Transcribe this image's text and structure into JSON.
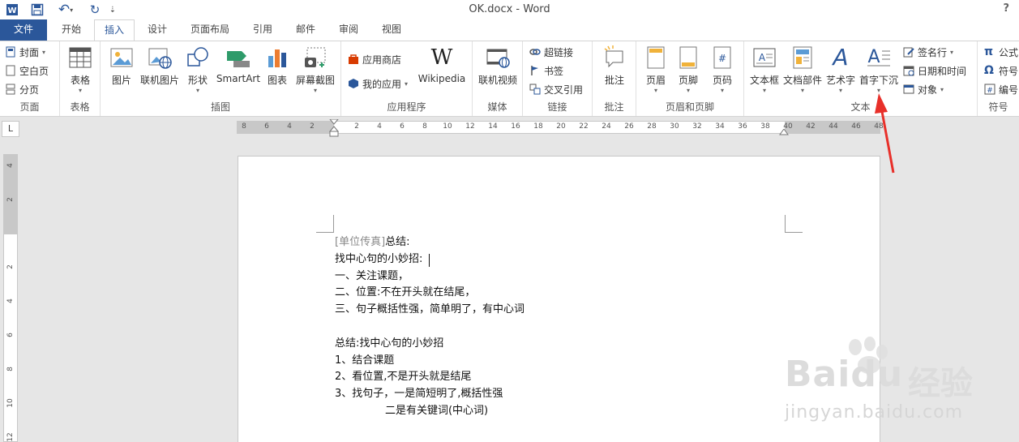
{
  "titlebar": {
    "title": "OK.docx - Word",
    "help": "?",
    "undo": "↶",
    "redo": "↻",
    "save": "💾",
    "customize": "⇣"
  },
  "tabs": {
    "file": "文件",
    "home": "开始",
    "insert": "插入",
    "design": "设计",
    "layout": "页面布局",
    "references": "引用",
    "mailings": "邮件",
    "review": "审阅",
    "view": "视图"
  },
  "ribbon": {
    "pages": {
      "label": "页面",
      "cover": "封面",
      "blank": "空白页",
      "break": "分页"
    },
    "tables": {
      "label": "表格",
      "table": "表格"
    },
    "illustrations": {
      "label": "插图",
      "picture": "图片",
      "online_picture": "联机图片",
      "shapes": "形状",
      "smartart": "SmartArt",
      "chart": "图表",
      "screenshot": "屏幕截图"
    },
    "apps": {
      "label": "应用程序",
      "store": "应用商店",
      "my_apps": "我的应用",
      "wikipedia": "Wikipedia"
    },
    "media": {
      "label": "媒体",
      "online_video": "联机视频"
    },
    "links": {
      "label": "链接",
      "hyperlink": "超链接",
      "bookmark": "书签",
      "cross_ref": "交叉引用"
    },
    "comments": {
      "label": "批注",
      "comment": "批注"
    },
    "header_footer": {
      "label": "页眉和页脚",
      "header": "页眉",
      "footer": "页脚",
      "page_number": "页码"
    },
    "text": {
      "label": "文本",
      "textbox": "文本框",
      "quick_parts": "文档部件",
      "wordart": "艺术字",
      "drop_cap": "首字下沉",
      "signature": "签名行",
      "datetime": "日期和时间",
      "object": "对象"
    },
    "symbols": {
      "label": "符号",
      "equation": "公式",
      "symbol": "符号",
      "number": "编号"
    }
  },
  "ruler": {
    "corner": "L",
    "h_left": [
      "8",
      "6",
      "4",
      "2"
    ],
    "h_right": [
      "2",
      "4",
      "6",
      "8",
      "10",
      "12",
      "14",
      "16",
      "18",
      "20",
      "22",
      "24",
      "26",
      "28",
      "30",
      "32",
      "34",
      "36",
      "38",
      "40",
      "42",
      "44",
      "46",
      "48"
    ],
    "v_top": [
      "4",
      "2"
    ],
    "v_bottom": [
      "2",
      "4",
      "6",
      "8",
      "10",
      "12"
    ]
  },
  "document": {
    "lines": [
      {
        "gray": "[单位传真]",
        "text": "总结:"
      },
      {
        "gray": "",
        "text": "找中心句的小妙招:"
      },
      {
        "gray": "",
        "text": "一、关注课题，"
      },
      {
        "gray": "",
        "text": "二、位置:不在开头就在结尾，"
      },
      {
        "gray": "",
        "text": "三、句子概括性强，简单明了，有中心词"
      },
      {
        "gray": "",
        "text": ""
      },
      {
        "gray": "",
        "text": "总结:找中心句的小妙招"
      },
      {
        "gray": "",
        "text": "1、结合课题"
      },
      {
        "gray": "",
        "text": "2、看位置,不是开头就是结尾"
      },
      {
        "gray": "",
        "text": "3、找句子，一是简短明了,概括性强"
      },
      {
        "gray": "",
        "text": "               二是有关键词(中心词)"
      }
    ]
  },
  "watermark": {
    "brand": "Bai",
    "brand2": "du",
    "cn": "经验",
    "url": "jingyan.baidu.com"
  },
  "colors": {
    "accent": "#2b579a",
    "arrow": "#e8302a"
  }
}
